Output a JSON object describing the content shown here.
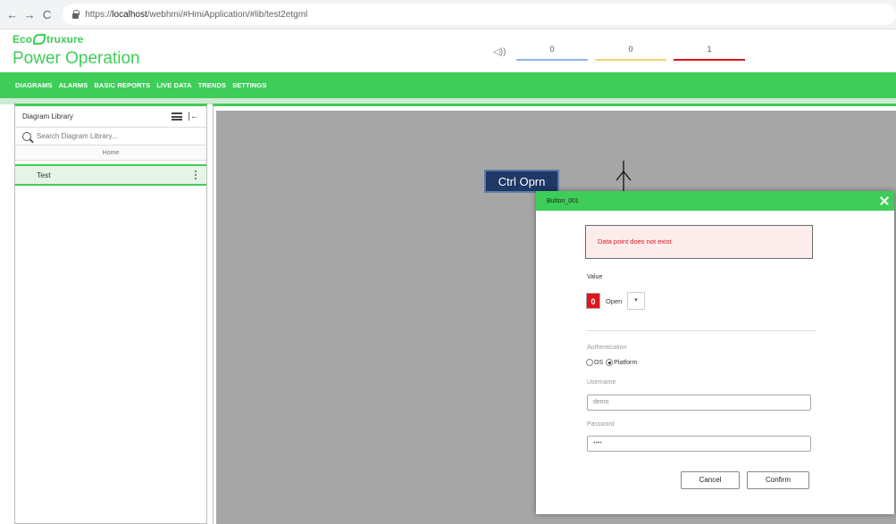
{
  "browser": {
    "back": "←",
    "forward": "→",
    "reload": "C",
    "url_scheme": "https://",
    "url_host": "localhost",
    "url_path": "/webhmi/#HmiApplication/#lib/test2etgml"
  },
  "header": {
    "logo_left": "Eco",
    "logo_right": "truxure",
    "app_title": "Power Operation"
  },
  "alarms": {
    "speaker": "◁))",
    "segments": [
      {
        "count": "0",
        "color": "#8ab6e8"
      },
      {
        "count": "0",
        "color": "#f2d36b"
      },
      {
        "count": "1",
        "color": "#e0141c"
      }
    ]
  },
  "nav": {
    "items": [
      "DIAGRAMS",
      "ALARMS",
      "BASIC REPORTS",
      "LIVE DATA",
      "TRENDS",
      "SETTINGS"
    ],
    "active": "DIAGRAMS"
  },
  "sidebar": {
    "title": "Diagram Library",
    "collapse": "|←",
    "search_placeholder": "Search Diagram Library...",
    "home": "Home",
    "items": [
      {
        "label": "Test"
      }
    ]
  },
  "canvas": {
    "ctrl_button_label": "Ctrl Oprn"
  },
  "dialog": {
    "title": "Button_001",
    "error": "Data point does not exist",
    "value_label": "Value",
    "state_icon": "0",
    "state_value": "Open",
    "dropdown_caret": "▾",
    "auth_label": "Authentication",
    "auth_options": [
      "OS",
      "Platform"
    ],
    "auth_selected": "Platform",
    "username_label": "Username",
    "username_value": "demo",
    "password_label": "Password",
    "password_value": "••••",
    "cancel_label": "Cancel",
    "confirm_label": "Confirm"
  },
  "colors": {
    "brand_green": "#3dcd58",
    "error_red": "#e0141c",
    "ctrl_button_blue": "#1f3865"
  }
}
